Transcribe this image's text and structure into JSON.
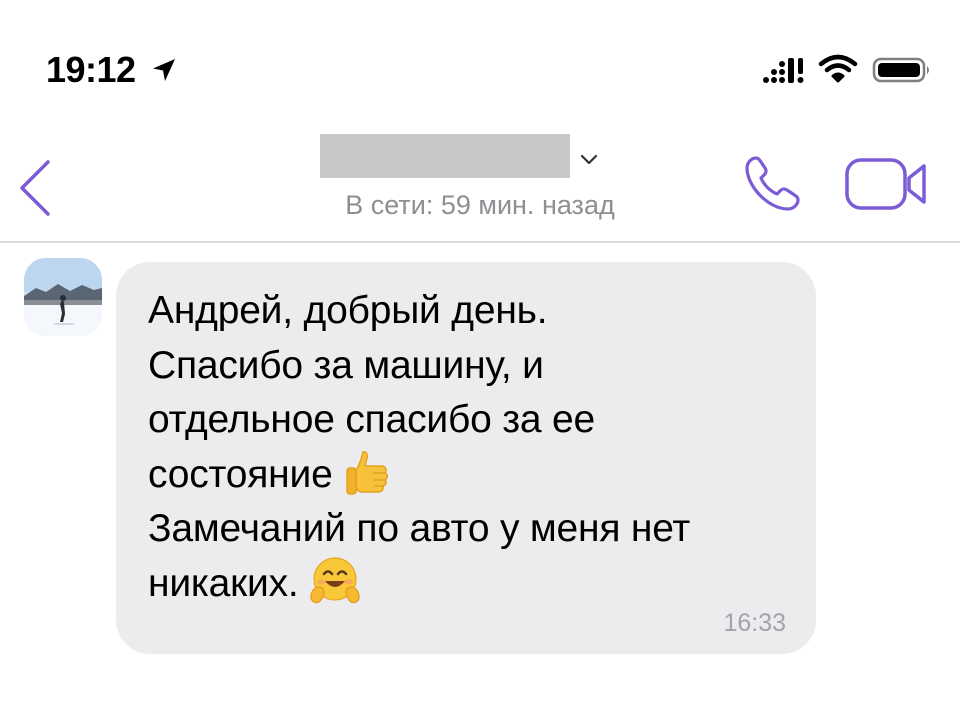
{
  "status_bar": {
    "time": "19:12",
    "icons": [
      "location-arrow-icon",
      "cellular-signal-icon",
      "wifi-icon",
      "battery-icon"
    ]
  },
  "header": {
    "contact_name": "",
    "presence": "В сети: 59 мин. назад",
    "icons": [
      "back-chevron-icon",
      "name-chevron-down-icon",
      "phone-icon",
      "video-camera-icon"
    ]
  },
  "message": {
    "lines": [
      "Андрей, добрый день.",
      "Спасибо за машину, и",
      "отдельное спасибо за ее",
      "состояние",
      "Замечаний по авто у меня нет",
      "никаких."
    ],
    "emojis": [
      "thumbs-up-emoji",
      "hugging-face-emoji"
    ],
    "time": "16:33"
  },
  "colors": {
    "accent": "#7b5cd6",
    "bubble": "#ececee",
    "secondary_text": "#8e8e93",
    "timestamp": "#a3a3a8",
    "divider": "#dcdcdc"
  }
}
